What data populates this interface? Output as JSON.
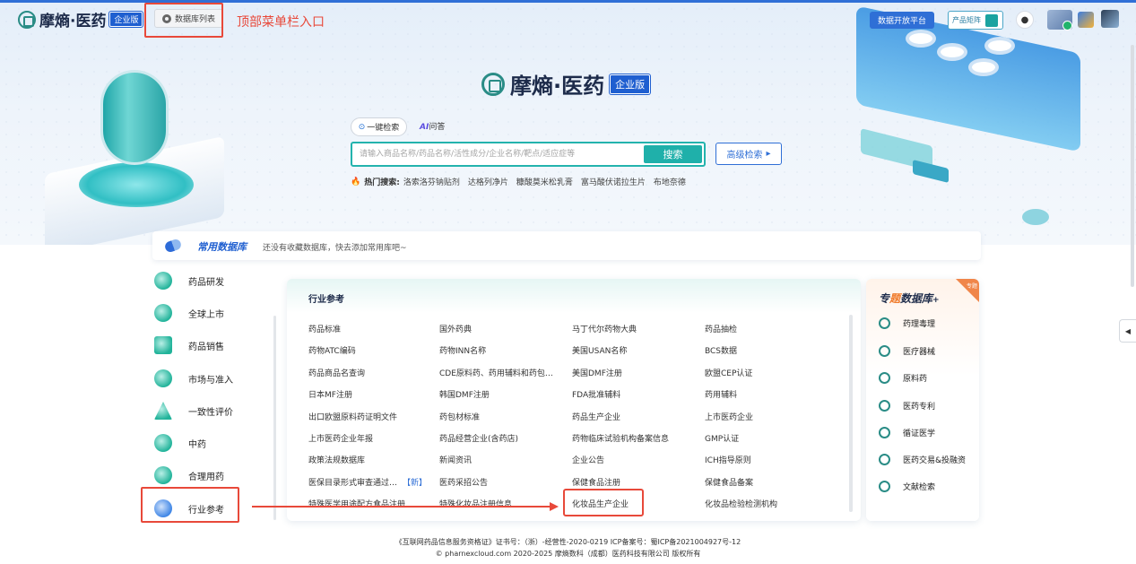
{
  "header": {
    "logo_text": "摩熵·医药",
    "logo_badge": "企业版",
    "db_list_button": "数据库列表",
    "annotation_text": "顶部菜单栏入口",
    "open_platform": "数据开放平台",
    "product_matrix": "产品矩阵"
  },
  "hero": {
    "logo_text": "摩熵·医药",
    "logo_badge": "企业版",
    "tab_search": "一键检索",
    "tab_ai_prefix": "AI",
    "tab_ai_suffix": "问答",
    "search_placeholder": "请输入商品名称/药品名称/活性成分/企业名称/靶点/适应症等",
    "search_button": "搜索",
    "advanced_search": "高级检索",
    "hot_label": "热门搜索:",
    "hot_items": [
      "洛索洛芬钠贴剂",
      "达格列净片",
      "糠酸莫米松乳膏",
      "富马酸伏诺拉生片",
      "布地奈德"
    ]
  },
  "common_db": {
    "title": "常用数据库",
    "desc": "还没有收藏数据库，快去添加常用库吧~"
  },
  "left_nav": {
    "items": [
      "药品研发",
      "全球上市",
      "药品销售",
      "市场与准入",
      "一致性评价",
      "中药",
      "合理用药",
      "行业参考"
    ]
  },
  "industry": {
    "title": "行业参考",
    "rows": [
      [
        "药品标准",
        "国外药典",
        "马丁代尔药物大典",
        "药品抽检"
      ],
      [
        "药物ATC编码",
        "药物INN名称",
        "美国USAN名称",
        "BCS数据"
      ],
      [
        "药品商品名查询",
        "CDE原料药、药用辅料和药包…",
        "美国DMF注册",
        "欧盟CEP认证"
      ],
      [
        "日本MF注册",
        "韩国DMF注册",
        "FDA批准辅料",
        "药用辅料"
      ],
      [
        "出口欧盟原料药证明文件",
        "药包材标准",
        "药品生产企业",
        "上市医药企业"
      ],
      [
        "上市医药企业年报",
        "药品经营企业(含药店)",
        "药物临床试验机构备案信息",
        "GMP认证"
      ],
      [
        "政策法规数据库",
        "新闻资讯",
        "企业公告",
        "ICH指导原则"
      ],
      [
        "医保目录形式审查通过…",
        "医药采招公告",
        "保健食品注册",
        "保健食品备案"
      ],
      [
        "特殊医学用途配方食品注册",
        "特殊化妆品注册信息",
        "化妆品生产企业",
        "化妆品检验检测机构"
      ]
    ],
    "new_tag": "【新】"
  },
  "special": {
    "title_a": "专",
    "title_b": "题",
    "title_c": "数据库",
    "title_star": "+",
    "ribbon": "专题",
    "items": [
      "药理毒理",
      "医疗器械",
      "原料药",
      "医药专利",
      "循证医学",
      "医药交易&投融资",
      "文献检索"
    ]
  },
  "footer": {
    "line1": "《互联网药品信息服务资格证》证书号：（浙）-经营性-2020-0219   ICP备案号：蜀ICP备2021004927号-12",
    "line2": "© pharnexcloud.com 2020-2025 摩熵数科（成都）医药科技有限公司 版权所有"
  },
  "colors": {
    "brand": "#2f6fd6",
    "teal": "#1fb0aa",
    "annotation": "#e8493a"
  }
}
